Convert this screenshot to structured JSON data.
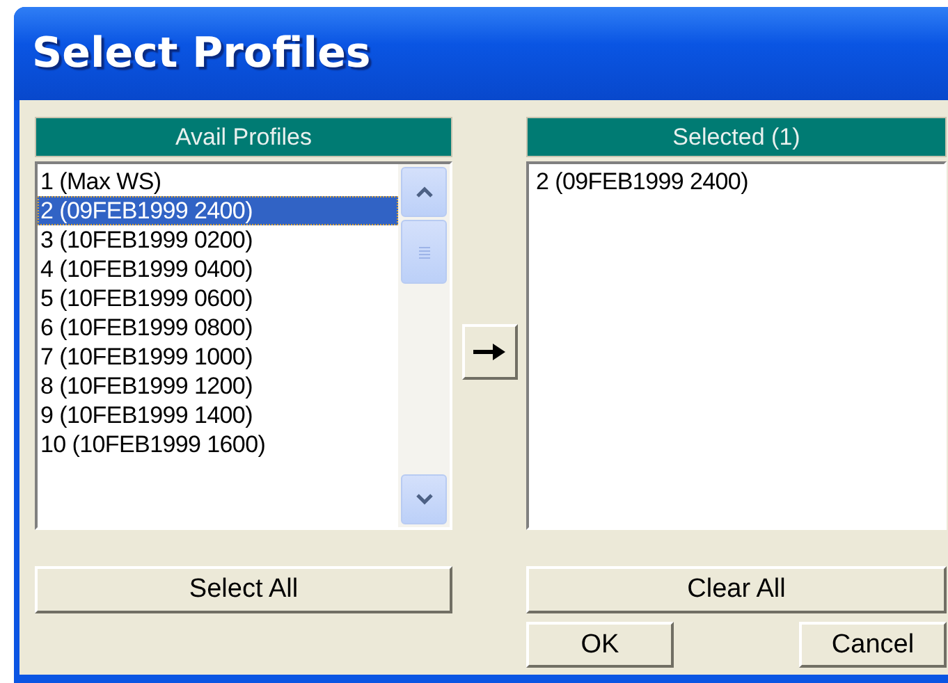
{
  "window": {
    "title": "Select Profiles"
  },
  "available": {
    "header": "Avail Profiles",
    "items": [
      {
        "label": "1 (Max WS)",
        "selected": false
      },
      {
        "label": "2 (09FEB1999 2400)",
        "selected": true
      },
      {
        "label": "3 (10FEB1999 0200)",
        "selected": false
      },
      {
        "label": "4 (10FEB1999 0400)",
        "selected": false
      },
      {
        "label": "5 (10FEB1999 0600)",
        "selected": false
      },
      {
        "label": "6 (10FEB1999 0800)",
        "selected": false
      },
      {
        "label": "7 (10FEB1999 1000)",
        "selected": false
      },
      {
        "label": "8 (10FEB1999 1200)",
        "selected": false
      },
      {
        "label": "9 (10FEB1999 1400)",
        "selected": false
      },
      {
        "label": "10 (10FEB1999 1600)",
        "selected": false
      }
    ]
  },
  "selected_list": {
    "header": "Selected  (1)",
    "items": [
      "2 (09FEB1999 2400)"
    ]
  },
  "buttons": {
    "select_all": "Select All",
    "clear_all": "Clear All",
    "ok": "OK",
    "cancel": "Cancel"
  }
}
